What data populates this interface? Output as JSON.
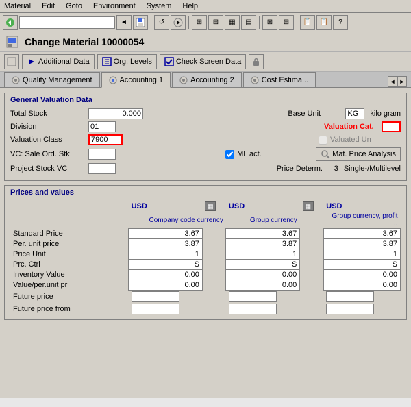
{
  "window": {
    "title": "Change Material 10000054"
  },
  "menu": {
    "items": [
      "Material",
      "Edit",
      "Goto",
      "Environment",
      "System",
      "Help"
    ]
  },
  "toolbar": {
    "input_value": ""
  },
  "action_bar": {
    "additional_data": "Additional Data",
    "org_levels": "Org. Levels",
    "check_screen_data": "Check Screen Data"
  },
  "tabs": [
    {
      "label": "Quality Management",
      "active": false
    },
    {
      "label": "Accounting 1",
      "active": true
    },
    {
      "label": "Accounting 2",
      "active": false
    },
    {
      "label": "Cost Estima...",
      "active": false
    }
  ],
  "general_valuation": {
    "section_title": "General Valuation Data",
    "total_stock_label": "Total Stock",
    "total_stock_value": "0.000",
    "base_unit_label": "Base Unit",
    "base_unit_code": "KG",
    "base_unit_name": "kilo gram",
    "division_label": "Division",
    "division_value": "01",
    "valuation_cat_label": "Valuation Cat.",
    "valuation_cat_value": "",
    "valuation_class_label": "Valuation Class",
    "valuation_class_value": "7900",
    "valuated_un_label": "Valuated Un",
    "ml_act_label": "ML act.",
    "vc_sale_label": "VC: Sale Ord. Stk",
    "vc_sale_value": "",
    "mat_price_btn": "Mat. Price Analysis",
    "project_stock_label": "Project Stock VC",
    "project_stock_value": "",
    "price_determ_label": "Price Determ.",
    "price_determ_code": "3",
    "price_determ_value": "Single-/Multilevel"
  },
  "prices_values": {
    "section_title": "Prices and values",
    "currency1": "USD",
    "currency2": "USD",
    "currency3": "USD",
    "col1_label": "Company code currency",
    "col2_label": "Group currency",
    "col3_label": "Group currency, profit ...",
    "rows": [
      {
        "label": "Standard Price",
        "v1": "3.67",
        "v2": "3.67",
        "v3": "3.67"
      },
      {
        "label": "Per. unit price",
        "v1": "3.87",
        "v2": "3.87",
        "v3": "3.87"
      },
      {
        "label": "Price Unit",
        "v1": "1",
        "v2": "1",
        "v3": "1"
      },
      {
        "label": "Prc. Ctrl",
        "v1": "S",
        "v2": "S",
        "v3": "S"
      },
      {
        "label": "Inventory Value",
        "v1": "0.00",
        "v2": "0.00",
        "v3": "0.00"
      },
      {
        "label": "Value/per.unit pr",
        "v1": "0.00",
        "v2": "0.00",
        "v3": "0.00"
      }
    ],
    "future_price_label": "Future price",
    "future_price_from_label": "Future price from"
  }
}
